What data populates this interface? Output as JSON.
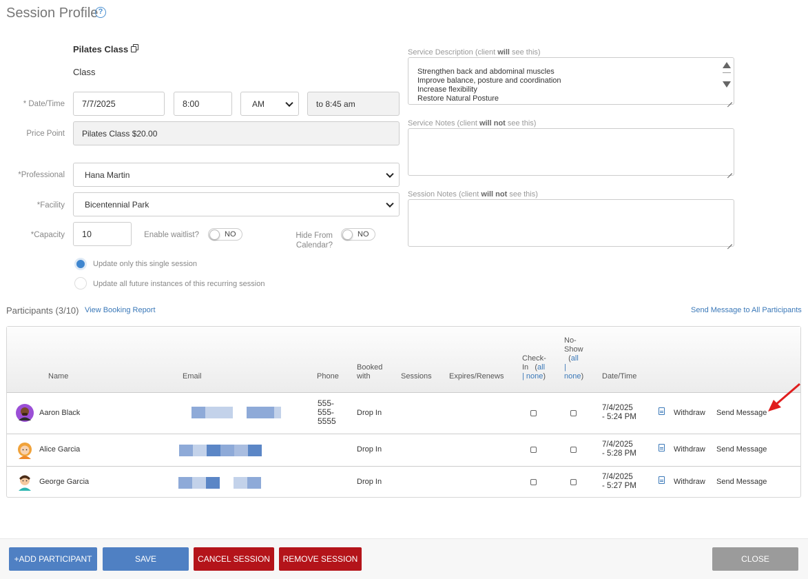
{
  "page": {
    "title": "Session Profile"
  },
  "session": {
    "name": "Pilates Class",
    "type": "Class",
    "labels": {
      "datetime": "* Date/Time",
      "price_point": "Price Point",
      "professional": "*Professional",
      "facility": "*Facility",
      "capacity": "*Capacity",
      "waitlist": "Enable waitlist?",
      "hide_from_calendar": "Hide From Calendar?"
    },
    "date": "7/7/2025",
    "time": "8:00",
    "ampm": "AM",
    "end_time": "to 8:45 am",
    "price_point": "Pilates Class $20.00",
    "professional": "Hana Martin",
    "facility": "Bicentennial Park",
    "capacity": "10",
    "waitlist_toggle": "NO",
    "hide_toggle": "NO",
    "update_options": [
      "Update only this single session",
      "Update all future instances of this recurring session"
    ]
  },
  "notes": {
    "service_description_label": [
      "Service Description (client ",
      "will",
      " see this)"
    ],
    "service_description_lines": [
      "Strengthen back and abdominal muscles",
      "Improve balance, posture and coordination",
      "Increase flexibility",
      "Restore Natural Posture"
    ],
    "service_notes_label": [
      "Service Notes (client ",
      "will not",
      " see this)"
    ],
    "session_notes_label": [
      "Session Notes (client ",
      "will not",
      " see this)"
    ]
  },
  "participants": {
    "title": "Participants (3/10)",
    "view_report": "View Booking Report",
    "send_all": "Send Message to All Participants",
    "headers": {
      "name": "Name",
      "email": "Email",
      "phone": "Phone",
      "booked_with": [
        "Booked",
        "with"
      ],
      "sessions": "Sessions",
      "expires": "Expires/Renews",
      "checkin": [
        "Check-",
        "In"
      ],
      "all": "all",
      "none": "none",
      "noshow": [
        "No-",
        "Show"
      ],
      "datetime": "Date/Time"
    },
    "rows": [
      {
        "name": "Aaron Black",
        "phone": [
          "555-",
          "555-",
          "5555"
        ],
        "booked": "Drop In",
        "date": [
          "7/4/2025",
          "- 5:24 PM"
        ],
        "withdraw": "Withdraw",
        "message": "Send Message"
      },
      {
        "name": "Alice Garcia",
        "phone": [],
        "booked": "Drop In",
        "date": [
          "7/4/2025",
          "- 5:28 PM"
        ],
        "withdraw": "Withdraw",
        "message": "Send Message"
      },
      {
        "name": "George Garcia",
        "phone": [],
        "booked": "Drop In",
        "date": [
          "7/4/2025",
          "- 5:27 PM"
        ],
        "withdraw": "Withdraw",
        "message": "Send Message"
      }
    ]
  },
  "footer": {
    "add": "+ADD PARTICIPANT",
    "save": "SAVE",
    "cancel": "CANCEL SESSION",
    "remove": "REMOVE SESSION",
    "close": "CLOSE"
  },
  "colors": {
    "link": "#3a78b8",
    "primary_button": "#4f80c3",
    "danger_button": "#b4141a",
    "close_button": "#9b9b9b",
    "annotation_arrow": "#e01e1e"
  }
}
